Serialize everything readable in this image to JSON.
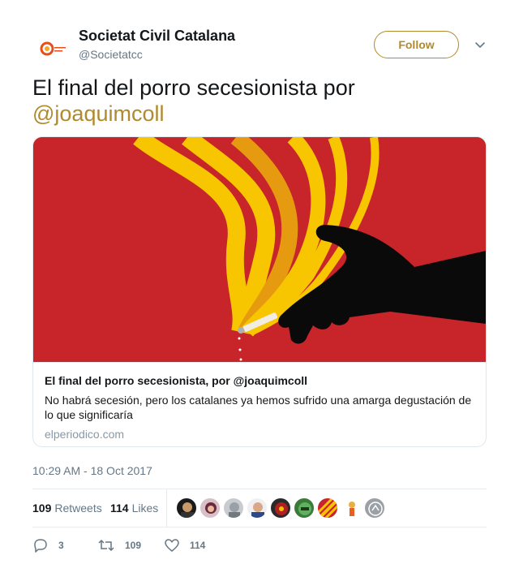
{
  "account": {
    "display_name": "Societat Civil Catalana",
    "handle": "@Societatcc",
    "avatar_icon": "scc-logo-icon"
  },
  "follow_label": "Follow",
  "tweet": {
    "text": "El final del porro secesionista por",
    "mention": "@joaquimcoll"
  },
  "card": {
    "image_icon": "hand-holding-joint-illustration",
    "title": "El final del porro secesionista, por @joaquimcoll",
    "description": "No habrá secesión, pero los catalanes ya hemos sufrido una amarga degustación de lo que significaría",
    "domain": "elperiodico.com"
  },
  "timestamp": "10:29 AM - 18 Oct 2017",
  "stats": {
    "retweets_count": "109",
    "retweets_label": "Retweets",
    "likes_count": "114",
    "likes_label": "Likes"
  },
  "actions": {
    "reply_count": "3",
    "retweet_count": "109",
    "like_count": "114"
  },
  "colors": {
    "accent": "#b08a2c",
    "card_background": "#c8252b",
    "muted": "#657786"
  }
}
